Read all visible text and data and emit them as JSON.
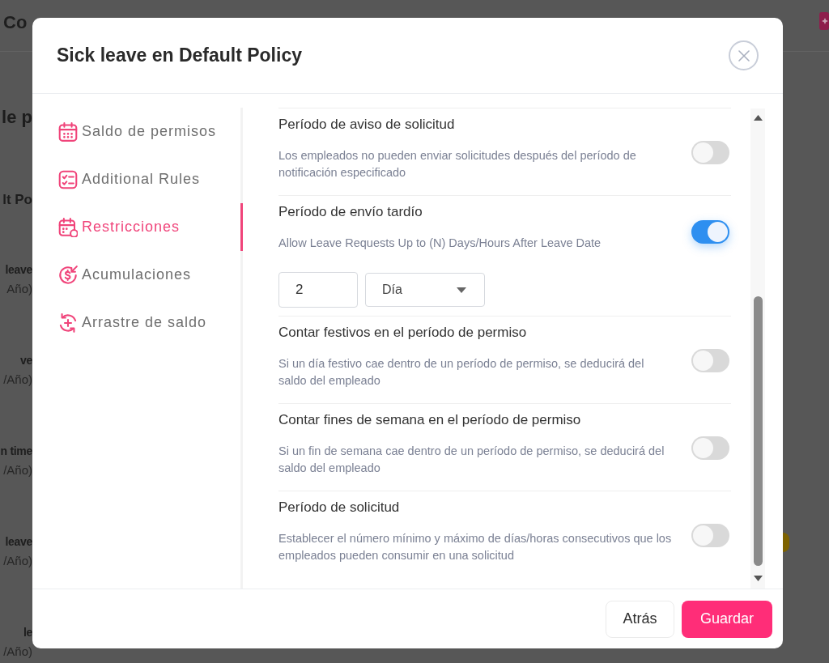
{
  "background_page": {
    "brand": "Co",
    "heading": "le p",
    "policy": "lt Po",
    "leave_types": [
      {
        "name": "leave",
        "period": "Año)"
      },
      {
        "name": "ve",
        "period": "/Año)"
      },
      {
        "name": "n time",
        "period": "/Año)"
      },
      {
        "name": "leave",
        "period": "/Año)"
      },
      {
        "name": "le",
        "period": "/Año)"
      }
    ]
  },
  "dialog": {
    "title": "Sick leave en Default Policy",
    "nav": [
      {
        "label": "Saldo de permisos",
        "selected": false
      },
      {
        "label": "Additional Rules",
        "selected": false
      },
      {
        "label": "Restricciones",
        "selected": true
      },
      {
        "label": "Acumulaciones",
        "selected": false
      },
      {
        "label": "Arrastre de saldo",
        "selected": false
      }
    ],
    "settings": [
      {
        "title": "Período de aviso de solicitud",
        "description": "Los empleados no pueden enviar solicitudes después del período de notificación especificado",
        "on": false
      },
      {
        "title": "Período de envío tardío",
        "description": "Allow Leave Requests Up to (N) Days/Hours After Leave Date",
        "on": true,
        "amount": "2",
        "unit": "Día"
      },
      {
        "title": "Contar festivos en el período de permiso",
        "description": "Si un día festivo cae dentro de un período de permiso, se deducirá del saldo del empleado",
        "on": false
      },
      {
        "title": "Contar fines de semana en el período de permiso",
        "description": "Si un fin de semana cae dentro de un período de permiso, se deducirá del saldo del empleado",
        "on": false
      },
      {
        "title": "Período de solicitud",
        "description": "Establecer el número mínimo y máximo de días/horas consecutivos que los empleados pueden consumir en una solicitud",
        "on": false
      }
    ],
    "buttons": [
      {
        "label": "Atrás",
        "kind": "secondary"
      },
      {
        "label": "Guardar",
        "kind": "primary"
      }
    ]
  }
}
